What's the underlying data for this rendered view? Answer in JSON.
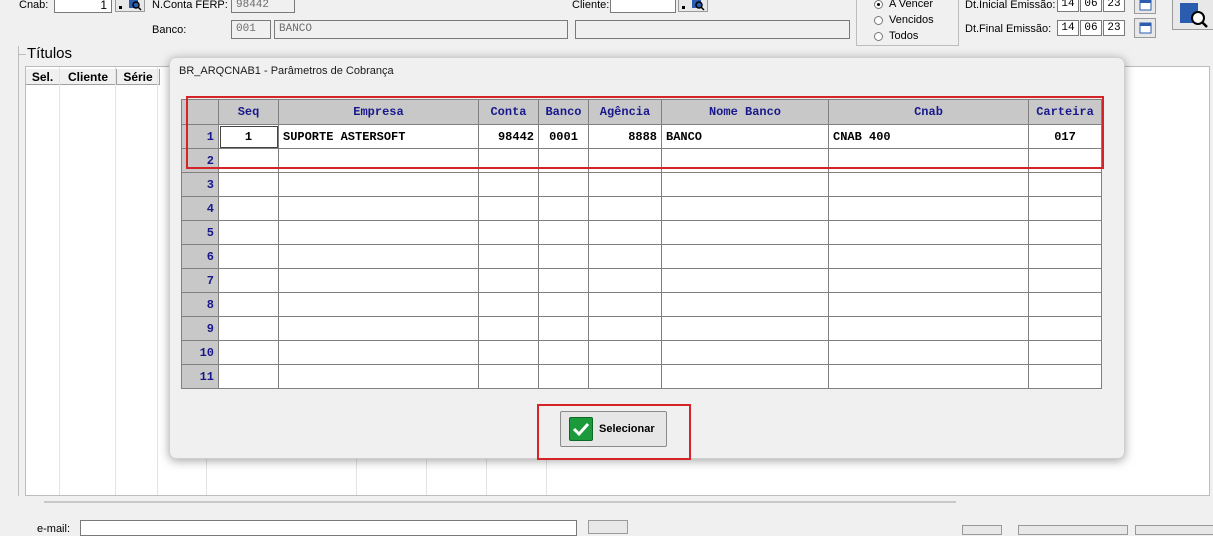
{
  "top": {
    "cnab_label": "Cnab:",
    "cnab_value": "1",
    "nconta_label": "N.Conta FERP:",
    "nconta_value": "98442",
    "banco_label": "Banco:",
    "banco_code": "001",
    "banco_name": "BANCO",
    "cliente_label": "Cliente:",
    "cliente_value": "",
    "cliente_name": "",
    "filters": [
      {
        "label": "A Vencer",
        "selected": true
      },
      {
        "label": "Vencidos",
        "selected": false
      },
      {
        "label": "Todos",
        "selected": false
      }
    ],
    "dt_inicial_label": "Dt.Inicial Emissão:",
    "dt_inicial": [
      "14",
      "06",
      "23"
    ],
    "dt_final_label": "Dt.Final Emissão:",
    "dt_final": [
      "14",
      "06",
      "23"
    ]
  },
  "titulos": {
    "label": "Títulos",
    "columns": [
      "Sel.",
      "Cliente",
      "Série"
    ]
  },
  "footer": {
    "email_label": "e-mail:"
  },
  "dialog": {
    "title": "BR_ARQCNAB1 - Parâmetros de Cobrança",
    "columns": [
      "Seq",
      "Empresa",
      "Conta",
      "Banco",
      "Agência",
      "Nome Banco",
      "Cnab",
      "Carteira"
    ],
    "rows": [
      {
        "n": "1",
        "seq": "1",
        "empresa": "SUPORTE ASTERSOFT",
        "conta": "98442",
        "banco": "0001",
        "agencia": "8888",
        "nome_banco": "BANCO",
        "cnab": "CNAB 400",
        "carteira": "017"
      },
      {
        "n": "2",
        "seq": "",
        "empresa": "",
        "conta": "",
        "banco": "",
        "agencia": "",
        "nome_banco": "",
        "cnab": "",
        "carteira": ""
      },
      {
        "n": "3",
        "seq": "",
        "empresa": "",
        "conta": "",
        "banco": "",
        "agencia": "",
        "nome_banco": "",
        "cnab": "",
        "carteira": ""
      },
      {
        "n": "4",
        "seq": "",
        "empresa": "",
        "conta": "",
        "banco": "",
        "agencia": "",
        "nome_banco": "",
        "cnab": "",
        "carteira": ""
      },
      {
        "n": "5",
        "seq": "",
        "empresa": "",
        "conta": "",
        "banco": "",
        "agencia": "",
        "nome_banco": "",
        "cnab": "",
        "carteira": ""
      },
      {
        "n": "6",
        "seq": "",
        "empresa": "",
        "conta": "",
        "banco": "",
        "agencia": "",
        "nome_banco": "",
        "cnab": "",
        "carteira": ""
      },
      {
        "n": "7",
        "seq": "",
        "empresa": "",
        "conta": "",
        "banco": "",
        "agencia": "",
        "nome_banco": "",
        "cnab": "",
        "carteira": ""
      },
      {
        "n": "8",
        "seq": "",
        "empresa": "",
        "conta": "",
        "banco": "",
        "agencia": "",
        "nome_banco": "",
        "cnab": "",
        "carteira": ""
      },
      {
        "n": "9",
        "seq": "",
        "empresa": "",
        "conta": "",
        "banco": "",
        "agencia": "",
        "nome_banco": "",
        "cnab": "",
        "carteira": ""
      },
      {
        "n": "10",
        "seq": "",
        "empresa": "",
        "conta": "",
        "banco": "",
        "agencia": "",
        "nome_banco": "",
        "cnab": "",
        "carteira": ""
      },
      {
        "n": "11",
        "seq": "",
        "empresa": "",
        "conta": "",
        "banco": "",
        "agencia": "",
        "nome_banco": "",
        "cnab": "",
        "carteira": ""
      }
    ],
    "select_button": "Selecionar",
    "select_icon": "check-icon",
    "highlight_color": "#d4242a"
  }
}
